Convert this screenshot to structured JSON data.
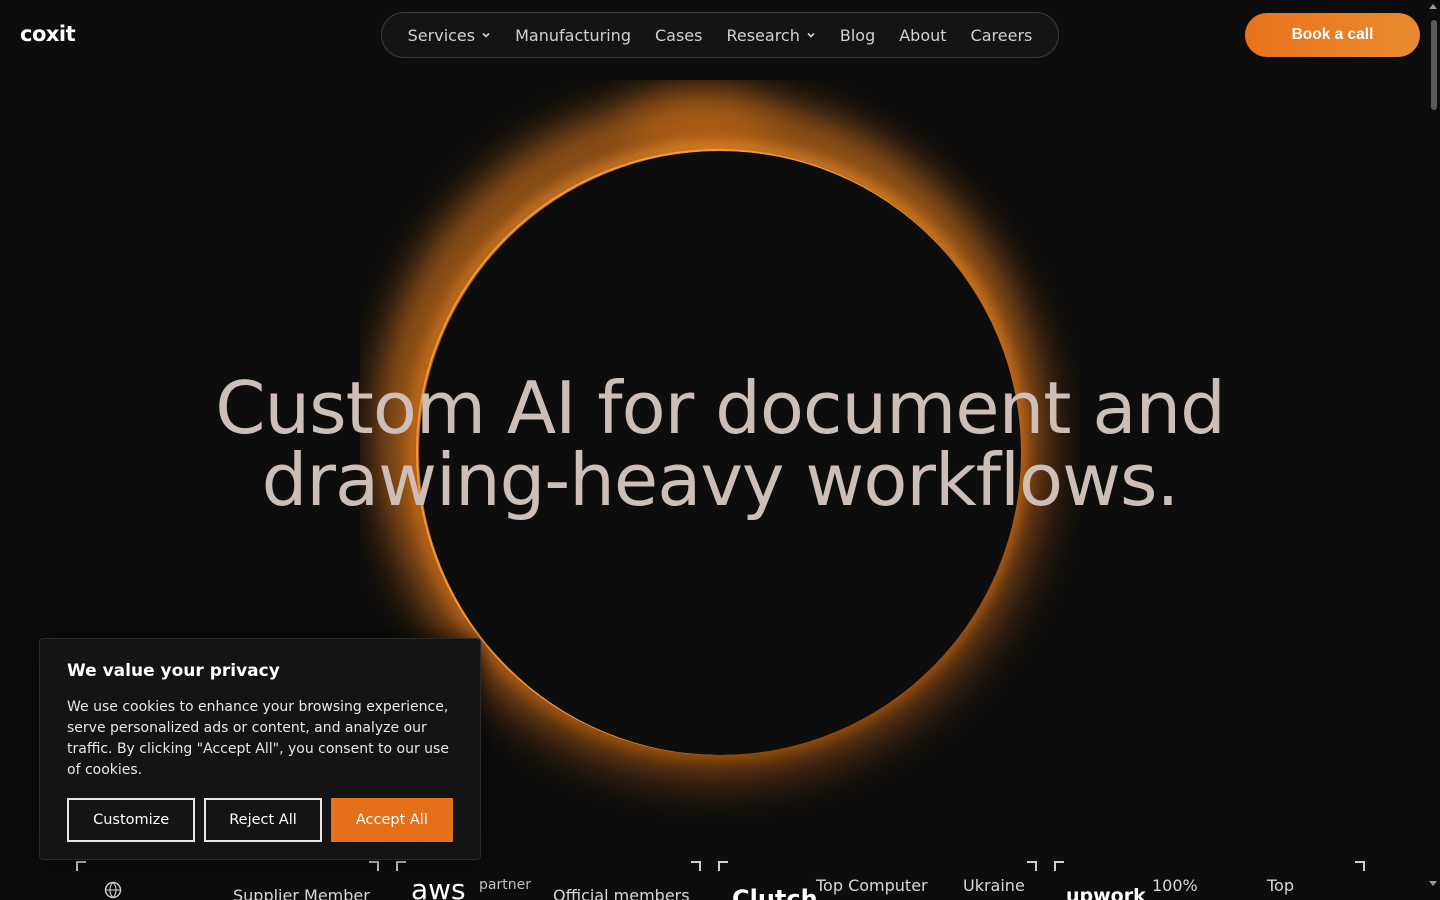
{
  "brand": {
    "logo_text": "coxit",
    "accent": "#e9731c"
  },
  "nav": {
    "items": [
      {
        "label": "Services",
        "has_dropdown": true
      },
      {
        "label": "Manufacturing",
        "has_dropdown": false
      },
      {
        "label": "Cases",
        "has_dropdown": false
      },
      {
        "label": "Research",
        "has_dropdown": true
      },
      {
        "label": "Blog",
        "has_dropdown": false
      },
      {
        "label": "About",
        "has_dropdown": false
      },
      {
        "label": "Careers",
        "has_dropdown": false
      }
    ],
    "cta_label": "Book a call"
  },
  "hero": {
    "line1": "Custom AI for document and",
    "line2": "drawing-heavy workflows."
  },
  "badges": [
    {
      "logo": "",
      "text": "Supplier Member"
    },
    {
      "logo": "aws",
      "sub": "partner",
      "text": "Official members"
    },
    {
      "logo": "Clutch",
      "text": "Top Computer",
      "text2": "Ukraine"
    },
    {
      "logo": "upwork",
      "text": "100%",
      "text2": "Top"
    }
  ],
  "cookie": {
    "title": "We value your privacy",
    "body": "We use cookies to enhance your browsing experience, serve personalized ads or content, and analyze our traffic. By clicking \"Accept All\", you consent to our use of cookies.",
    "customize_label": "Customize",
    "reject_label": "Reject All",
    "accept_label": "Accept All"
  }
}
